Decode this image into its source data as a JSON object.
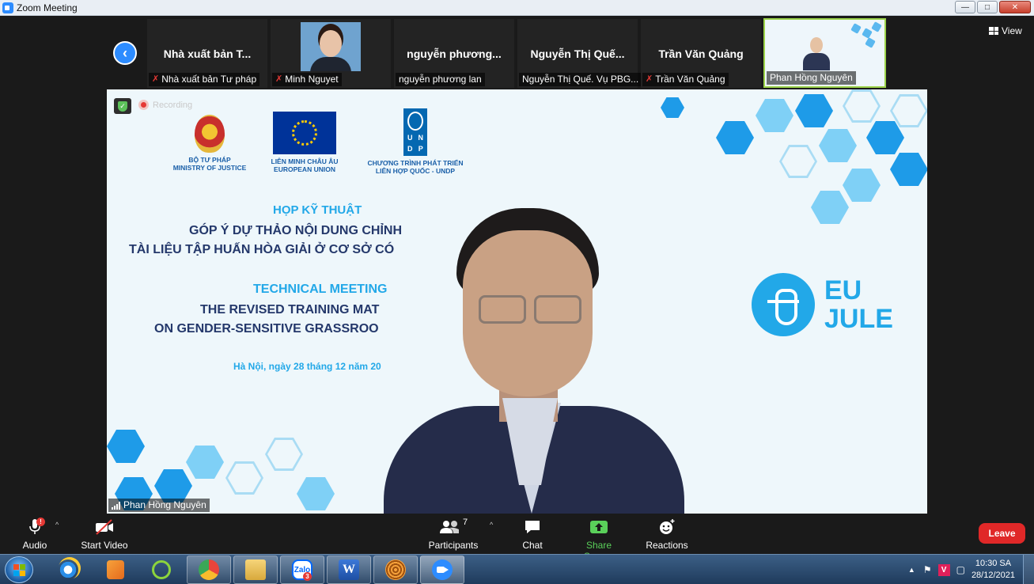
{
  "window": {
    "title": "Zoom Meeting"
  },
  "gallery": {
    "tiles": [
      {
        "name": "Nhà xuất bản T...",
        "label": "Nhà xuất bản Tư pháp",
        "muted": true,
        "video": false
      },
      {
        "name": "",
        "label": "Minh Nguyet",
        "muted": true,
        "video": true
      },
      {
        "name": "nguyễn phương...",
        "label": "nguyễn phương lan",
        "muted": false,
        "video": false
      },
      {
        "name": "Nguyễn Thị Quế...",
        "label": "Nguyễn Thị Quế. Vụ PBG...",
        "muted": false,
        "video": false
      },
      {
        "name": "Trần Văn Quảng",
        "label": "Trần Văn Quảng",
        "muted": true,
        "video": false
      },
      {
        "name": "",
        "label": "Phan Hồng Nguyên",
        "muted": false,
        "video": true,
        "active": true
      }
    ],
    "view_label": "View"
  },
  "main_video": {
    "recording_label": "Recording",
    "speaker_name": "Phan Hồng Nguyên",
    "slide": {
      "logo_moj": {
        "line1": "BỘ TƯ PHÁP",
        "line2": "MINISTRY OF JUSTICE"
      },
      "logo_eu": {
        "line1": "LIÊN MINH CHÂU ÂU",
        "line2": "EUROPEAN UNION"
      },
      "logo_undp": {
        "line1": "CHƯƠNG TRÌNH PHÁT TRIỂN",
        "line2": "LIÊN HỢP QUỐC - UNDP",
        "letters": [
          "U",
          "N",
          "D",
          "P"
        ]
      },
      "heading_vi": "HỌP KỸ THUẬT",
      "title_vi_1": "GÓP Ý DỰ THẢO NỘI DUNG CHỈNH",
      "title_vi_2": "TÀI LIỆU TẬP HUẤN HÒA GIẢI Ở CƠ SỞ CÓ",
      "heading_en": "TECHNICAL MEETING",
      "title_en_1": "THE REVISED TRAINING MAT",
      "title_en_2": "ON GENDER-SENSITIVE GRASSROO",
      "date": "Hà Nội, ngày 28 tháng 12 năm 20",
      "brand_line1": "EU",
      "brand_line2": "JULE"
    }
  },
  "toolbar": {
    "audio": "Audio",
    "start_video": "Start Video",
    "participants": "Participants",
    "participants_count": "7",
    "chat": "Chat",
    "share_screen": "Share Screen",
    "reactions": "Reactions",
    "leave": "Leave",
    "audio_alert": "!"
  },
  "taskbar": {
    "zalo_label": "Zalo",
    "zalo_badge": "3",
    "time": "10:30 SA",
    "date": "28/12/2021"
  },
  "colors": {
    "zoom_blue": "#2d8cff",
    "leave_red": "#e02828",
    "share_green": "#5ad05a",
    "slide_blue": "#22a8e8"
  }
}
